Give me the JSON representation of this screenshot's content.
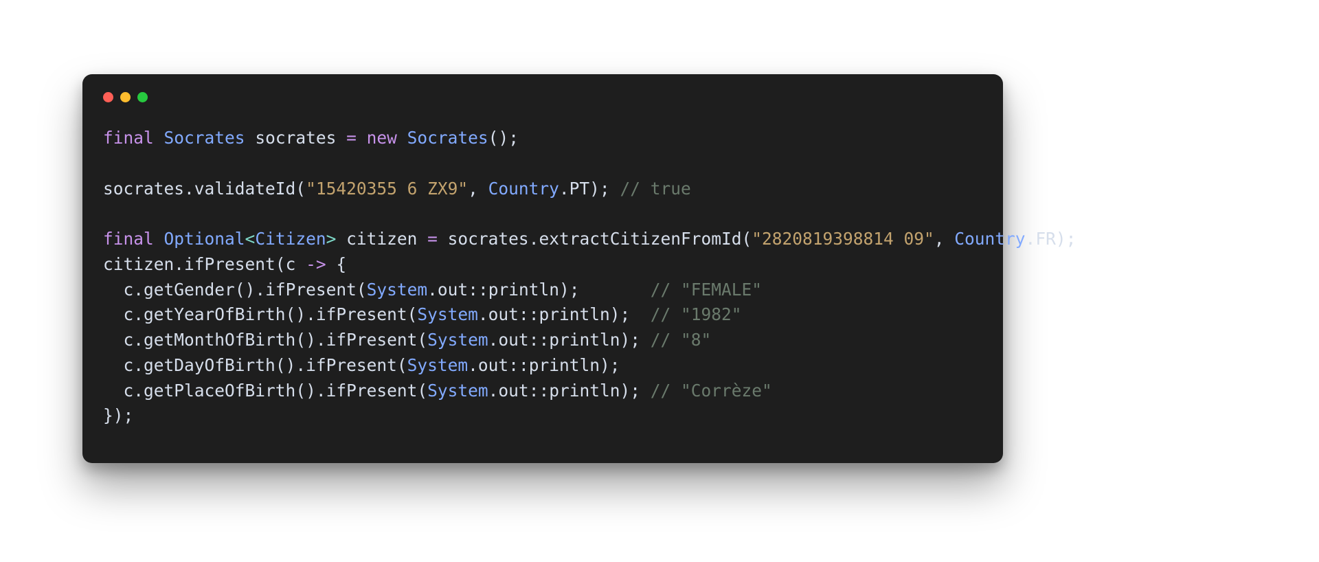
{
  "titlebar": {
    "red": "close",
    "yellow": "minimize",
    "green": "zoom"
  },
  "t": {
    "final": "final",
    "new": "new",
    "Socrates": "Socrates",
    "socrates_var": "socrates",
    "eq": "=",
    "open_paren": "(",
    "close_paren": ")",
    "semi": ";",
    "dot": ".",
    "comma": ",",
    "lt": "<",
    "gt": ">",
    "open_brace": "{",
    "close_brace": "}",
    "arrow": "->",
    "dcolon": "::",
    "validateId": "validateId",
    "str_pt_id": "\"15420355 6 ZX9\"",
    "Country": "Country",
    "PT": "PT",
    "cmt_true": "// true",
    "Optional": "Optional",
    "Citizen": "Citizen",
    "citizen_var": "citizen",
    "extractCitizenFromId": "extractCitizenFromId",
    "str_fr_id": "\"2820819398814 09\"",
    "FR": "FR",
    "ifPresent": "ifPresent",
    "c_var": "c",
    "System": "System",
    "out": "out",
    "println": "println",
    "getGender": "getGender",
    "cmt_female": "// \"FEMALE\"",
    "getYearOfBirth": "getYearOfBirth",
    "cmt_1982": "// \"1982\"",
    "getMonthOfBirth": "getMonthOfBirth",
    "cmt_8": "// \"8\"",
    "getDayOfBirth": "getDayOfBirth",
    "getPlaceOfBirth": "getPlaceOfBirth",
    "cmt_correze": "// \"Corrèze\""
  }
}
